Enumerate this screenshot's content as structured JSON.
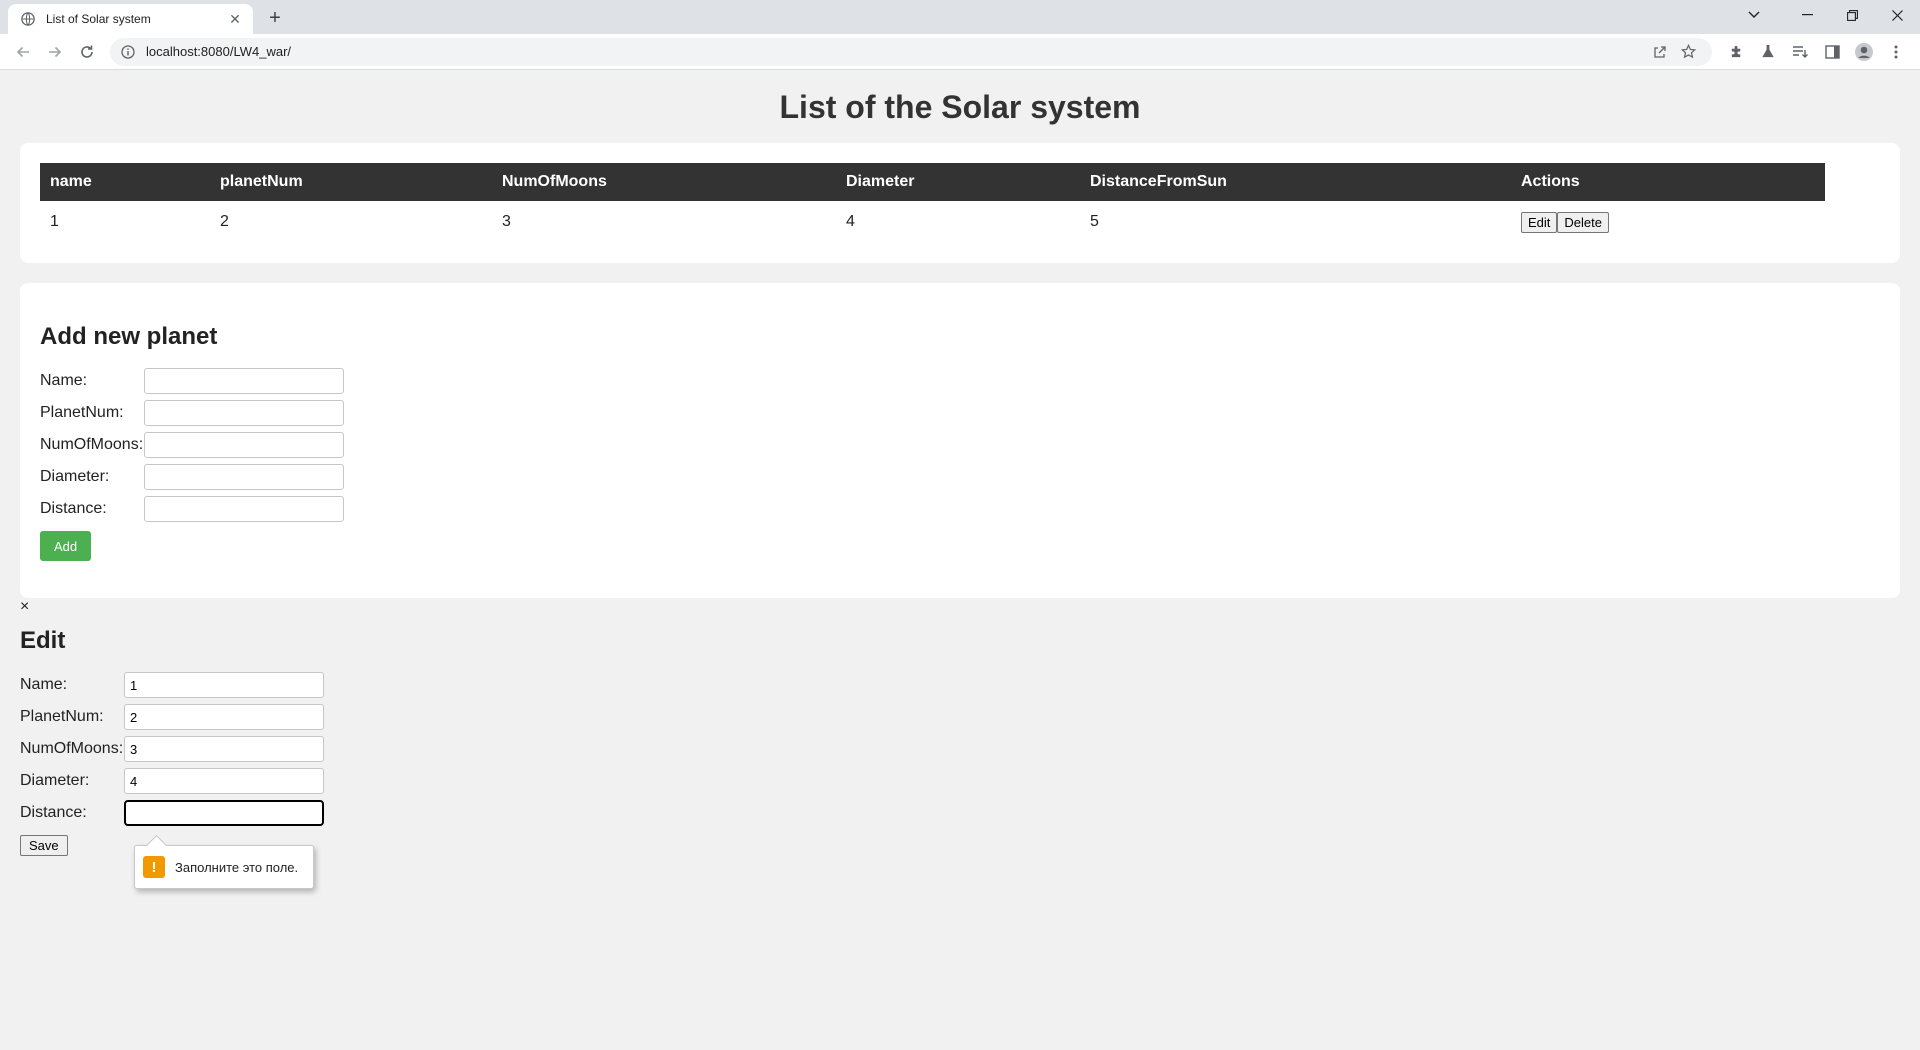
{
  "browser": {
    "tab_title": "List of Solar system",
    "url": "localhost:8080/LW4_war/"
  },
  "page": {
    "title": "List of the Solar system"
  },
  "table": {
    "headers": [
      "name",
      "planetNum",
      "NumOfMoons",
      "Diameter",
      "DistanceFromSun",
      "Actions"
    ],
    "rows": [
      {
        "name": "1",
        "planetNum": "2",
        "numOfMoons": "3",
        "diameter": "4",
        "distanceFromSun": "5"
      }
    ],
    "edit_label": "Edit",
    "delete_label": "Delete"
  },
  "add_form": {
    "title": "Add new planet",
    "labels": [
      "Name:",
      "PlanetNum:",
      "NumOfMoons:",
      "Diameter:",
      "Distance:"
    ],
    "values": [
      "",
      "",
      "",
      "",
      ""
    ],
    "submit_label": "Add"
  },
  "edit_form": {
    "close_label": "×",
    "title": "Edit",
    "labels": [
      "Name:",
      "PlanetNum:",
      "NumOfMoons:",
      "Diameter:",
      "Distance:"
    ],
    "values": [
      "1",
      "2",
      "3",
      "4",
      ""
    ],
    "submit_label": "Save",
    "validation_message": "Заполните это поле."
  },
  "colors": {
    "header_bg": "#333333",
    "add_button": "#4caf50",
    "warning": "#f29900"
  }
}
